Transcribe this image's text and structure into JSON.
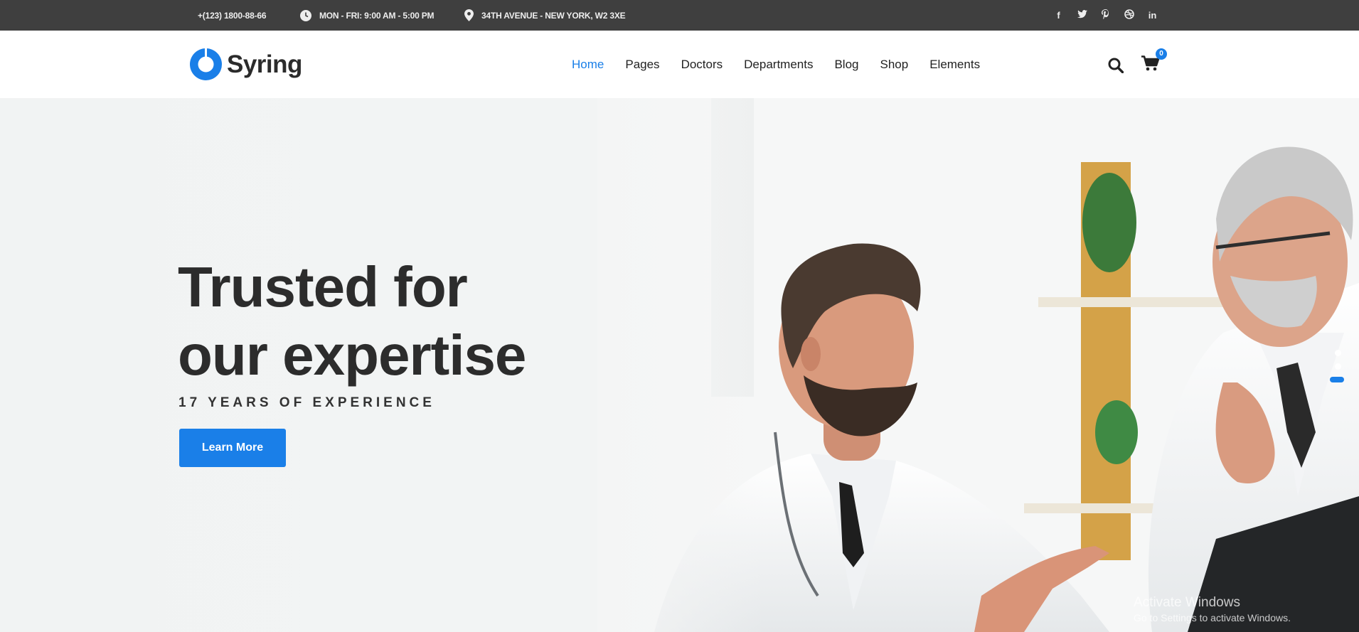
{
  "topbar": {
    "phone": "+(123) 1800-88-66",
    "hours": "MON - FRI: 9:00 AM - 5:00 PM",
    "address": "34TH AVENUE - NEW YORK, W2 3XE",
    "social": [
      "facebook-icon",
      "twitter-icon",
      "pinterest-icon",
      "dribbble-icon",
      "linkedin-icon"
    ]
  },
  "header": {
    "logo_text": "Syring",
    "nav": [
      "Home",
      "Pages",
      "Doctors",
      "Departments",
      "Blog",
      "Shop",
      "Elements"
    ],
    "active": "Home",
    "cart_count": "0"
  },
  "hero": {
    "title_line1": "Trusted for",
    "title_line2": "our expertise",
    "subtitle": "17 YEARS OF EXPERIENCE",
    "button": "Learn More",
    "slides": 3,
    "active_slide": 3
  },
  "watermark": {
    "line1": "Activate Windows",
    "line2": "Go to Settings to activate Windows."
  },
  "colors": {
    "accent": "#1a7fe8",
    "topbar": "#3f3f3f",
    "heading": "#2c2c2c"
  }
}
